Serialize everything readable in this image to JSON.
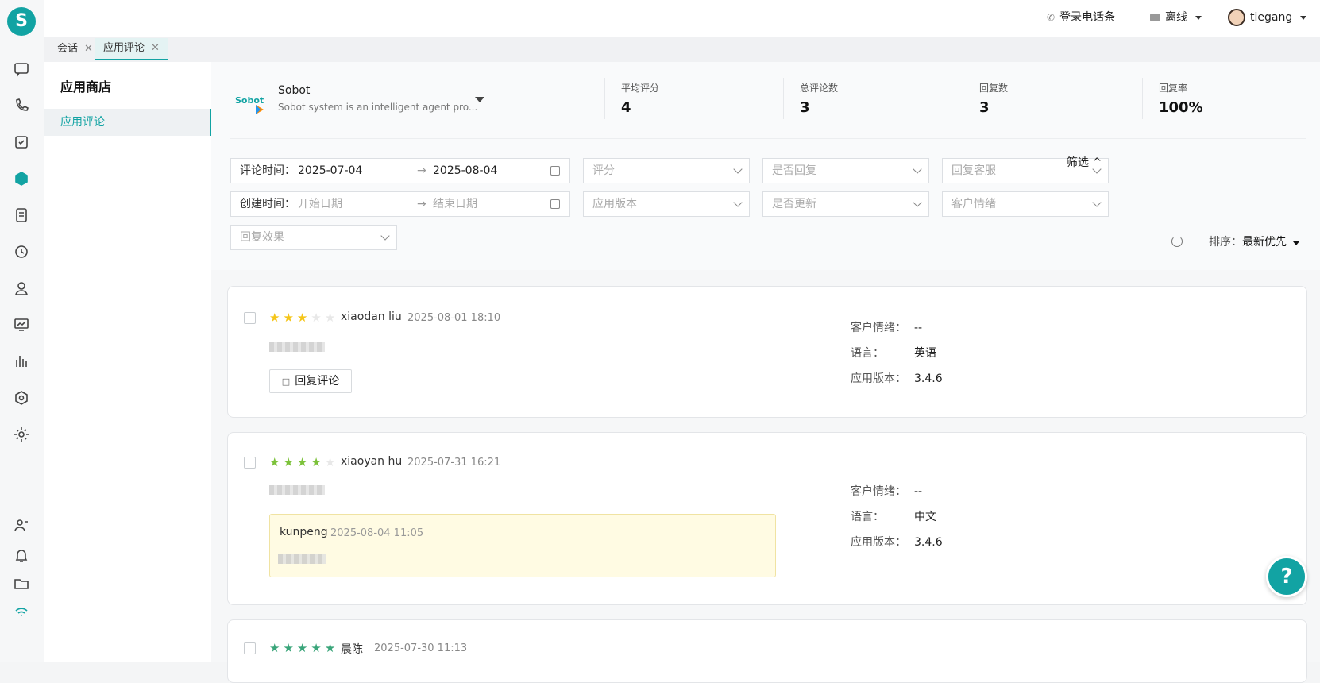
{
  "rail": {
    "logo_letter": "S",
    "icons": [
      "chat-icon",
      "phone-icon",
      "task-icon",
      "appstore-icon",
      "ticket-icon",
      "history-icon",
      "customer-icon",
      "monitor-icon",
      "report-icon",
      "robot-icon",
      "settings-icon",
      "agent-status-icon",
      "bell-icon",
      "folder-icon",
      "wifi-icon"
    ]
  },
  "topbar": {
    "phone_label": "登录电话条",
    "status_label": "离线",
    "username": "tiegang"
  },
  "tabs": [
    {
      "label": "会话"
    },
    {
      "label": "应用评论"
    }
  ],
  "sidebar": {
    "title": "应用商店",
    "items": [
      {
        "label": "应用评论"
      }
    ]
  },
  "app": {
    "logo_text": "Sobot",
    "name": "Sobot",
    "description": "Sobot system is an intelligent agent pro..."
  },
  "stats": [
    {
      "label": "平均评分",
      "value": "4"
    },
    {
      "label": "总评论数",
      "value": "3"
    },
    {
      "label": "回复数",
      "value": "3"
    },
    {
      "label": "回复率",
      "value": "100%"
    }
  ],
  "filters": {
    "comment_time_label": "评论时间：",
    "comment_start": "2025-07-04",
    "comment_end": "2025-08-04",
    "create_time_label": "创建时间：",
    "create_start_placeholder": "开始日期",
    "create_end_placeholder": "结束日期",
    "arrow": "→",
    "rating": "评分",
    "is_replied": "是否回复",
    "reply_agent": "回复客服",
    "app_version": "应用版本",
    "is_updated": "是否更新",
    "sentiment": "客户情绪",
    "reply_effect": "回复效果",
    "filter_toggle": "筛选 ^",
    "sort_label": "排序：",
    "sort_value": "最新优先"
  },
  "colors": {
    "accent": "#12a3a3",
    "star_yellow": "#f5c518",
    "star_green": "#7cc23a",
    "star_teal": "#3aa57a"
  },
  "reviews": [
    {
      "rating": 3,
      "author": "xiaodan liu",
      "time": "2025-08-01 18:10",
      "reply_button": "回复评论",
      "sentiment_label": "客户情绪：",
      "sentiment": "--",
      "language_label": "语言：",
      "language": "英语",
      "version_label": "应用版本：",
      "version": "3.4.6"
    },
    {
      "rating": 4,
      "author": "xiaoyan hu",
      "time": "2025-07-31 16:21",
      "reply_author": "kunpeng",
      "reply_time": "2025-08-04 11:05",
      "sentiment_label": "客户情绪：",
      "sentiment": "--",
      "language_label": "语言：",
      "language": "中文",
      "version_label": "应用版本：",
      "version": "3.4.6"
    },
    {
      "rating": 5,
      "author": "晨陈",
      "time": "2025-07-30 11:13"
    }
  ],
  "help_button": "?"
}
